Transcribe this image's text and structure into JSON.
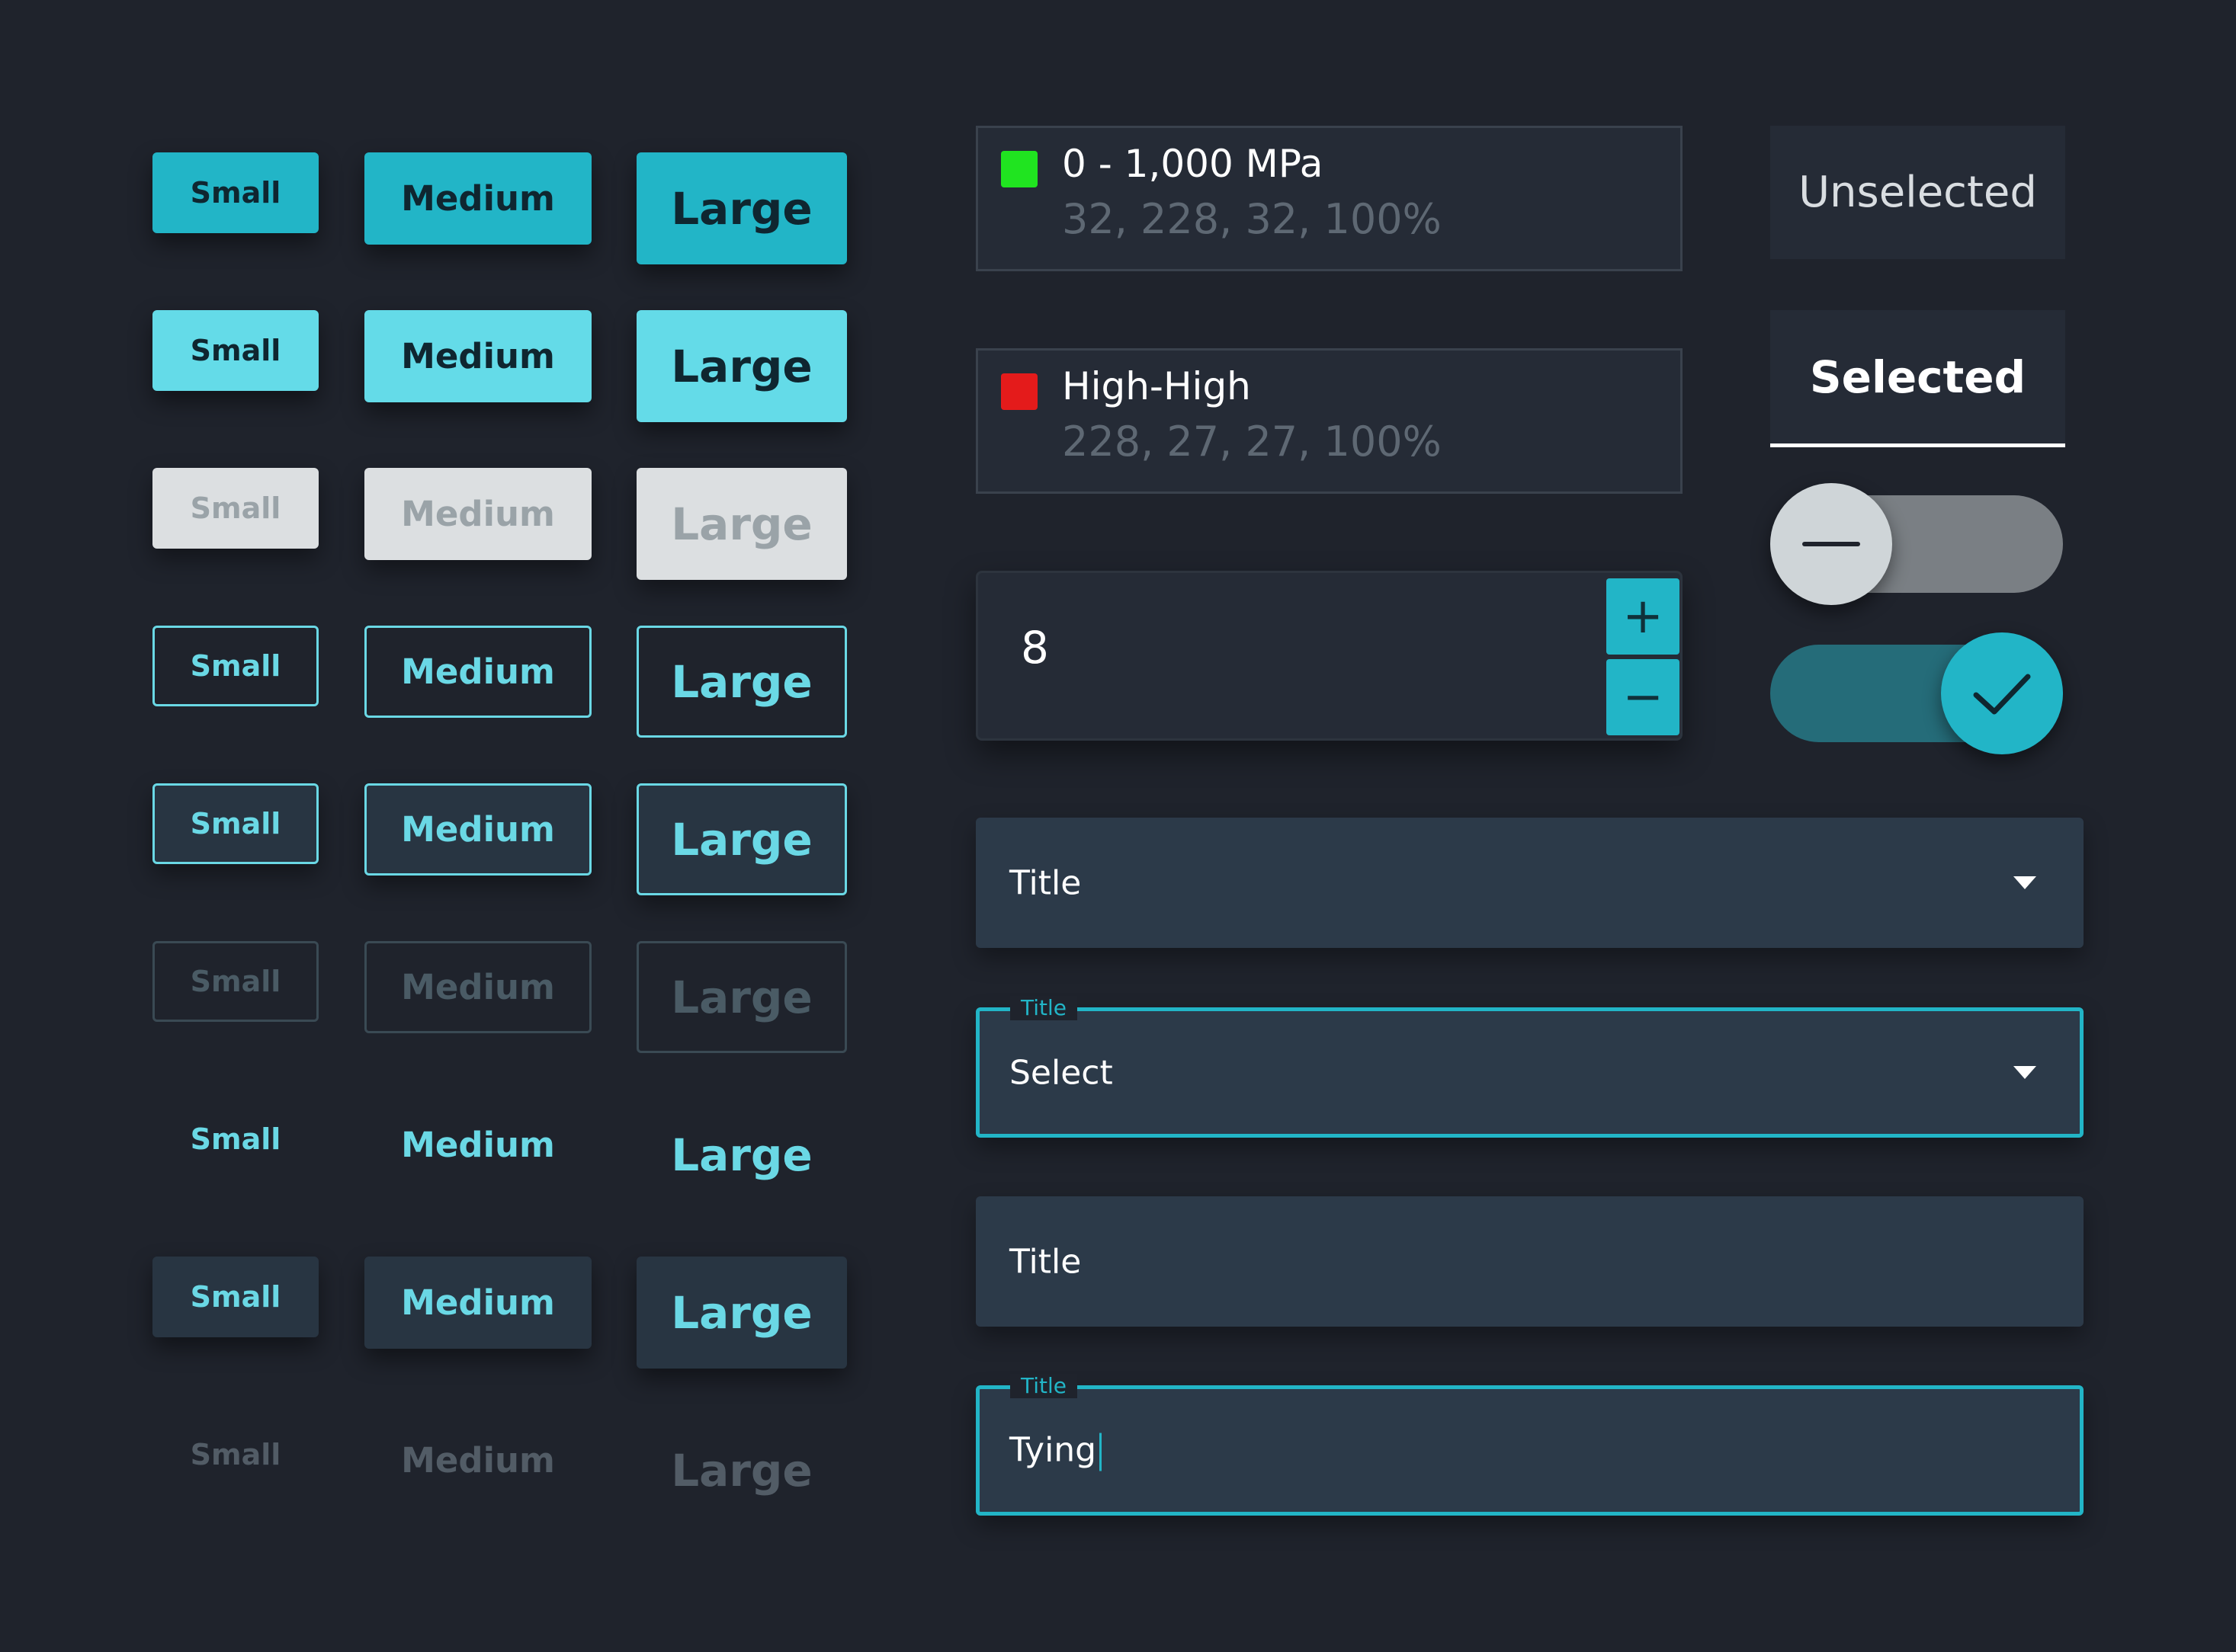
{
  "buttons": {
    "sizes": {
      "small": "Small",
      "medium": "Medium",
      "large": "Large"
    }
  },
  "legend": {
    "items": [
      {
        "label": "0 - 1,000 MPa",
        "value": "32, 228, 32, 100%",
        "color": "#20e420"
      },
      {
        "label": "High-High",
        "value": "228, 27, 27, 100%",
        "color": "#e41b1b"
      }
    ]
  },
  "stepper": {
    "value": "8",
    "increment_icon": "plus-icon",
    "decrement_icon": "minus-icon",
    "increment_symbol": "+",
    "decrement_symbol": "−"
  },
  "tabs": {
    "unselected_label": "Unselected",
    "selected_label": "Selected"
  },
  "toggles": {
    "off_icon": "minus-icon",
    "on_icon": "check-icon",
    "off_state": false,
    "on_state": true
  },
  "select_default": {
    "placeholder": "Title"
  },
  "select_focused": {
    "label": "Title",
    "value": "Select"
  },
  "text_default": {
    "placeholder": "Title"
  },
  "text_focused": {
    "label": "Title",
    "value": "Tying"
  },
  "colors": {
    "background": "#1f232c",
    "accent": "#22b5c7",
    "accent_light": "#64dbe8",
    "surface": "#2c3a49"
  }
}
